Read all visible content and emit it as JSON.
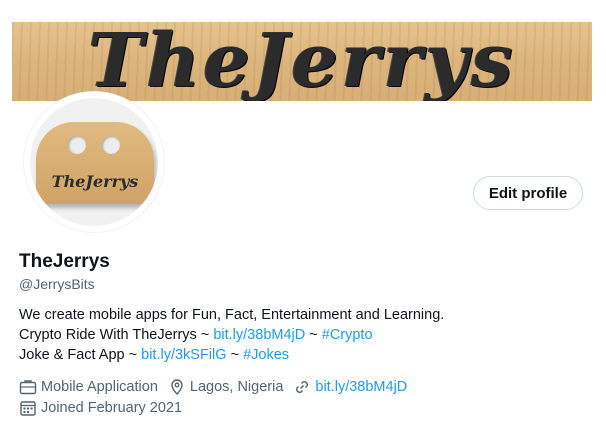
{
  "banner": {
    "text": "TheJerrys"
  },
  "avatar": {
    "text": "TheJerrys"
  },
  "profile": {
    "edit_label": "Edit profile",
    "display_name": "TheJerrys",
    "handle": "@JerrysBits"
  },
  "bio": {
    "line1": "We create mobile apps for Fun, Fact, Entertainment and Learning.",
    "line2_text": "Crypto Ride With TheJerrys ~ ",
    "line2_link": "bit.ly/38bM4jD",
    "line2_sep": " ~ ",
    "line2_hashtag": "#Crypto",
    "line3_text": "Joke & Fact App ~ ",
    "line3_link": "bit.ly/3kSFilG",
    "line3_sep": " ~ ",
    "line3_hashtag": "#Jokes"
  },
  "meta": {
    "category": "Mobile Application",
    "location": "Lagos, Nigeria",
    "website": "bit.ly/38bM4jD",
    "joined": "Joined February 2021"
  },
  "icons": {
    "category": "briefcase-icon",
    "location": "location-pin-icon",
    "website": "link-icon",
    "joined": "calendar-icon"
  },
  "colors": {
    "link": "#1d9bf0",
    "secondary": "#536471",
    "primary": "#0f1419"
  }
}
